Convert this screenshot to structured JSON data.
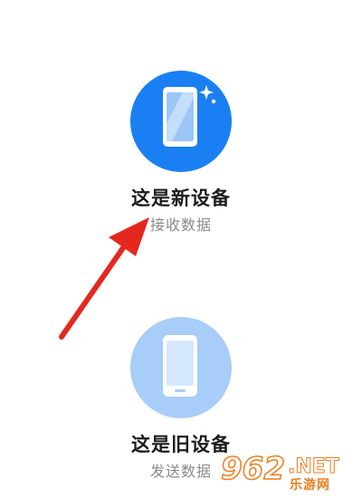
{
  "options": {
    "new_device": {
      "title": "这是新设备",
      "subtitle": "接收数据",
      "circle_color": "#1a7ff3"
    },
    "old_device": {
      "title": "这是旧设备",
      "subtitle": "发送数据",
      "circle_color": "#a7cdf8"
    }
  },
  "icons": {
    "new_device_icon": "phone-icon",
    "sparkle_icon": "sparkle-icon",
    "old_device_icon": "phone-icon",
    "annotation": "red-arrow"
  },
  "watermark": {
    "number": "962",
    "net": ".NET",
    "chinese": "乐游网",
    "color": "#f07c1a"
  }
}
